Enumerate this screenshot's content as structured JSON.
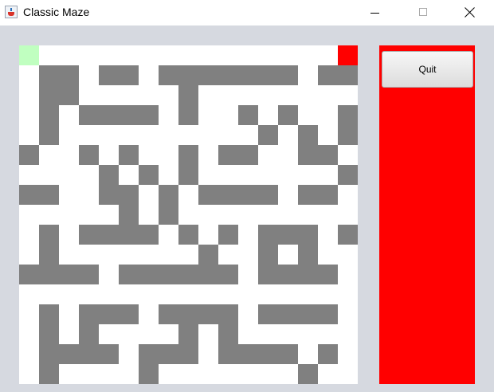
{
  "window": {
    "title": "Classic Maze",
    "icon": "java-cup-icon"
  },
  "window_controls": [
    "minimize-icon",
    "maximize-icon",
    "close-icon"
  ],
  "maze": {
    "grid_size": 17,
    "wall_color": "#808080",
    "path_color": "#ffffff",
    "start_color": "#c0ffc0",
    "goal_color": "#ff0000",
    "start_cell": [
      0,
      0
    ],
    "goal_cell": [
      16,
      0
    ],
    "rows": [
      ".___._____._____.",
      "_##.##_#######_##",
      "_##.....#_......_",
      "_#_####_#._#_#._#",
      "_#.._..._...#_#_#",
      "#._#_#_.#.##._##",
      "_.._#_#_#_..__._#",
      "##._##.#_####.##.",
      "_..._#_#._..._._.",
      "_#_####_#_#.###_#",
      "_#.._..._#..#.#._",
      "####_######_####.",
      "_............._._",
      "_#_###_####_####_",
      "_#.#....#.#......",
      "_####_###_####_#_",
      "_#.._.#._._.._#._"
    ]
  },
  "side_panel": {
    "color": "#ff0000",
    "quit_label": "Quit"
  }
}
